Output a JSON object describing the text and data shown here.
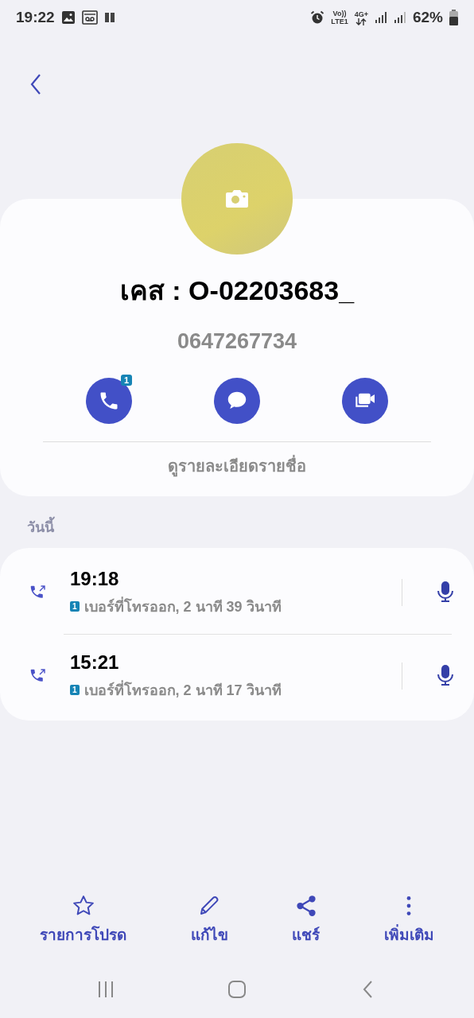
{
  "status_bar": {
    "time": "19:22",
    "volte": "Vo))",
    "lte": "LTE1",
    "network": "4G+",
    "battery": "62%"
  },
  "contact": {
    "name": "เคส : O-02203683_",
    "phone": "0647267734"
  },
  "actions": [
    {
      "kind": "call",
      "badge": "1"
    },
    {
      "kind": "message"
    },
    {
      "kind": "video"
    }
  ],
  "details_link": "ดูรายละเอียดรายชื่อ",
  "history": {
    "heading": "วันนี้",
    "calls": [
      {
        "time": "19:18",
        "sim": "1",
        "detail": "เบอร์ที่โทรออก, 2 นาที 39 วินาที"
      },
      {
        "time": "15:21",
        "sim": "1",
        "detail": "เบอร์ที่โทรออก, 2 นาที 17 วินาที"
      }
    ]
  },
  "bottom_actions": [
    {
      "kind": "favorite",
      "label": "รายการโปรด"
    },
    {
      "kind": "edit",
      "label": "แก้ไข"
    },
    {
      "kind": "share",
      "label": "แชร์"
    },
    {
      "kind": "more",
      "label": "เพิ่มเติม"
    }
  ]
}
